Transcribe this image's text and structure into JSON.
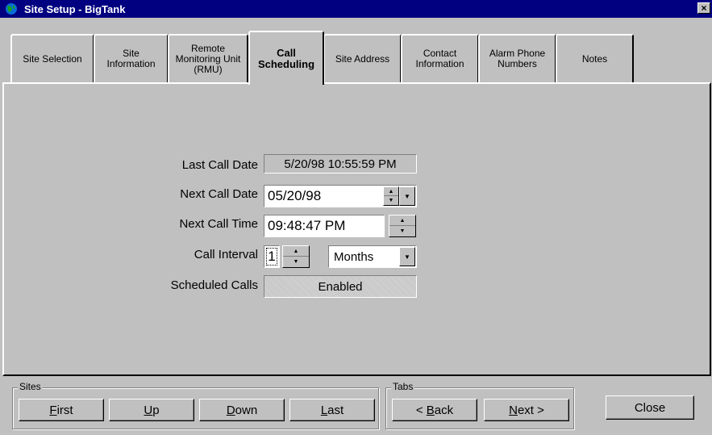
{
  "window": {
    "title": "Site Setup - BigTank",
    "close_glyph": "×"
  },
  "tabs": [
    {
      "label": "Site Selection"
    },
    {
      "label": "Site\nInformation"
    },
    {
      "label": "Remote\nMonitoring Unit\n(RMU)"
    },
    {
      "label": "Call\nScheduling"
    },
    {
      "label": "Site Address"
    },
    {
      "label": "Contact\nInformation"
    },
    {
      "label": "Alarm Phone\nNumbers"
    },
    {
      "label": "Notes"
    }
  ],
  "form": {
    "last_call_date_label": "Last Call Date",
    "last_call_date_value": "5/20/98 10:55:59 PM",
    "next_call_date_label": "Next Call Date",
    "next_call_date_value": "05/20/98",
    "next_call_time_label": "Next Call Time",
    "next_call_time_value": "09:48:47 PM",
    "call_interval_label": "Call Interval",
    "call_interval_value": "1",
    "call_interval_unit": "Months",
    "scheduled_calls_label": "Scheduled Calls",
    "scheduled_calls_value": "Enabled"
  },
  "sites_group": {
    "title": "Sites",
    "first": {
      "key": "F",
      "rest": "irst"
    },
    "up": {
      "key": "U",
      "rest": "p"
    },
    "down": {
      "key": "D",
      "rest": "own"
    },
    "last": {
      "key": "L",
      "rest": "ast"
    }
  },
  "tabs_group": {
    "title": "Tabs",
    "back": {
      "pre": "< ",
      "key": "B",
      "rest": "ack"
    },
    "next": {
      "key": "N",
      "rest": "ext >"
    }
  },
  "close_label": "Close",
  "colors": {
    "titlebar": "#000080",
    "face": "#c0c0c0",
    "field": "#ffffff"
  }
}
